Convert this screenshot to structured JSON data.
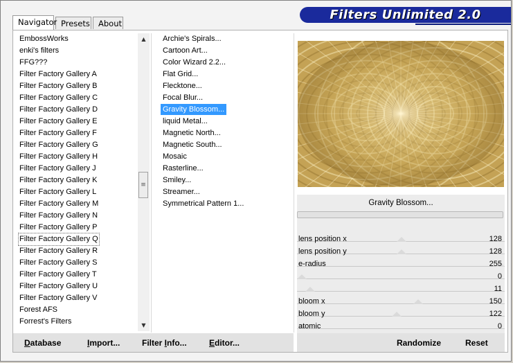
{
  "title": "Filters Unlimited 2.0",
  "tabs": [
    {
      "label": "Navigator"
    },
    {
      "label": "Presets"
    },
    {
      "label": "About"
    }
  ],
  "categories": [
    "EmbossWorks",
    "enki's filters",
    "FFG???",
    "Filter Factory Gallery A",
    "Filter Factory Gallery B",
    "Filter Factory Gallery C",
    "Filter Factory Gallery D",
    "Filter Factory Gallery E",
    "Filter Factory Gallery F",
    "Filter Factory Gallery G",
    "Filter Factory Gallery H",
    "Filter Factory Gallery J",
    "Filter Factory Gallery K",
    "Filter Factory Gallery L",
    "Filter Factory Gallery M",
    "Filter Factory Gallery N",
    "Filter Factory Gallery P",
    "Filter Factory Gallery Q",
    "Filter Factory Gallery R",
    "Filter Factory Gallery S",
    "Filter Factory Gallery T",
    "Filter Factory Gallery U",
    "Filter Factory Gallery V",
    "Forest AFS",
    "Forrest's Filters"
  ],
  "selected_category": "Filter Factory Gallery Q",
  "filters": [
    "Archie's Spirals...",
    "Cartoon Art...",
    "Color Wizard 2.2...",
    "Flat Grid...",
    "Flecktone...",
    "Focal Blur...",
    "Gravity Blossom...",
    "liquid Metal...",
    "Magnetic North...",
    "Magnetic South...",
    "Mosaic",
    "Rasterline...",
    "Smiley...",
    "Streamer...",
    "Symmetrical Pattern 1..."
  ],
  "selected_filter": "Gravity Blossom...",
  "preview_label": "Gravity Blossom...",
  "params": [
    {
      "label": "lens position x",
      "value": "128",
      "level": 128
    },
    {
      "label": "lens position y",
      "value": "128",
      "level": 128
    },
    {
      "label": "e-radius",
      "value": "255",
      "level": 255
    },
    {
      "label": "",
      "value": "0",
      "level": 0
    },
    {
      "label": "",
      "value": "11",
      "level": 11
    },
    {
      "label": "bloom x",
      "value": "150",
      "level": 150
    },
    {
      "label": "bloom y",
      "value": "122",
      "level": 122
    },
    {
      "label": "atomic",
      "value": "0",
      "level": 0
    }
  ],
  "buttons": {
    "database": {
      "ul": "D",
      "rest": "atabase"
    },
    "import": {
      "ul": "I",
      "rest": "mport..."
    },
    "filter_info": {
      "pre": "Filter ",
      "ul": "I",
      "rest": "nfo..."
    },
    "editor": {
      "ul": "E",
      "rest": "ditor..."
    },
    "randomize": "Randomize",
    "reset": "Reset"
  },
  "colors": {
    "banner": "#1a2a9c",
    "selection": "#3399ff",
    "preview_gold": "#c8a858"
  },
  "icons": {
    "scroll_up": "up-arrow-icon",
    "scroll_down": "down-arrow-icon",
    "scroll_grip": "grip-icon"
  }
}
